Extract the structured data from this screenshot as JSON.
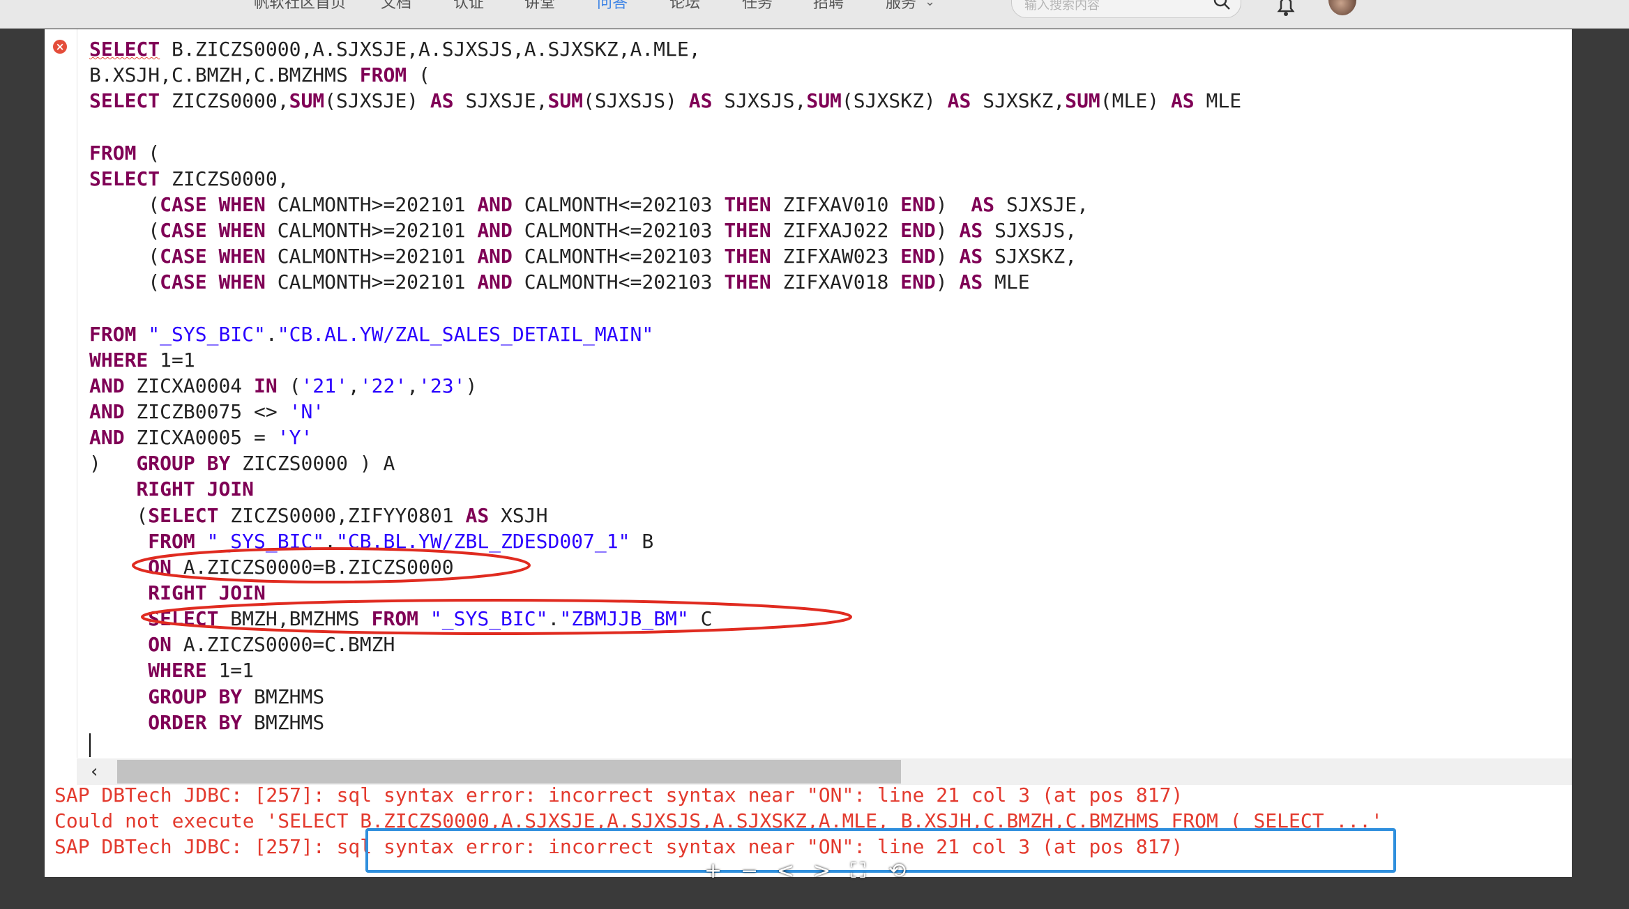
{
  "site_nav": {
    "items": [
      "帆软社区首页",
      "文档",
      "认证",
      "讲堂",
      "问答",
      "论坛",
      "任务",
      "招聘",
      "服务"
    ],
    "active_index": 4,
    "search_placeholder": "输入搜索内容",
    "icons": [
      "search-icon",
      "bell-icon",
      "avatar"
    ]
  },
  "editor": {
    "code_lines": [
      [
        {
          "t": "SELECT",
          "c": "kw",
          "squiggle": true
        },
        {
          "t": " B.ZICZS0000,A.SJXSJE,A.SJXSJS,A.SJXSKZ,A.MLE,"
        }
      ],
      [
        {
          "t": "B.XSJH,C.BMZH,C.BMZHMS "
        },
        {
          "t": "FROM",
          "c": "kw"
        },
        {
          "t": " ("
        }
      ],
      [
        {
          "t": "SELECT",
          "c": "kw"
        },
        {
          "t": " ZICZS0000,"
        },
        {
          "t": "SUM",
          "c": "kw"
        },
        {
          "t": "(SJXSJE) "
        },
        {
          "t": "AS",
          "c": "kw"
        },
        {
          "t": " SJXSJE,"
        },
        {
          "t": "SUM",
          "c": "kw"
        },
        {
          "t": "(SJXSJS) "
        },
        {
          "t": "AS",
          "c": "kw"
        },
        {
          "t": " SJXSJS,"
        },
        {
          "t": "SUM",
          "c": "kw"
        },
        {
          "t": "(SJXSKZ) "
        },
        {
          "t": "AS",
          "c": "kw"
        },
        {
          "t": " SJXSKZ,"
        },
        {
          "t": "SUM",
          "c": "kw"
        },
        {
          "t": "(MLE) "
        },
        {
          "t": "AS",
          "c": "kw"
        },
        {
          "t": " MLE"
        }
      ],
      [
        {
          "t": ""
        }
      ],
      [
        {
          "t": "FROM",
          "c": "kw"
        },
        {
          "t": " ("
        }
      ],
      [
        {
          "t": "SELECT",
          "c": "kw"
        },
        {
          "t": " ZICZS0000,"
        }
      ],
      [
        {
          "t": "     ("
        },
        {
          "t": "CASE",
          "c": "kw"
        },
        {
          "t": " "
        },
        {
          "t": "WHEN",
          "c": "kw"
        },
        {
          "t": " CALMONTH>=202101 "
        },
        {
          "t": "AND",
          "c": "kw"
        },
        {
          "t": " CALMONTH<=202103 "
        },
        {
          "t": "THEN",
          "c": "kw"
        },
        {
          "t": " ZIFXAV010 "
        },
        {
          "t": "END",
          "c": "kw"
        },
        {
          "t": ")  "
        },
        {
          "t": "AS",
          "c": "kw"
        },
        {
          "t": " SJXSJE,"
        }
      ],
      [
        {
          "t": "     ("
        },
        {
          "t": "CASE",
          "c": "kw"
        },
        {
          "t": " "
        },
        {
          "t": "WHEN",
          "c": "kw"
        },
        {
          "t": " CALMONTH>=202101 "
        },
        {
          "t": "AND",
          "c": "kw"
        },
        {
          "t": " CALMONTH<=202103 "
        },
        {
          "t": "THEN",
          "c": "kw"
        },
        {
          "t": " ZIFXAJ022 "
        },
        {
          "t": "END",
          "c": "kw"
        },
        {
          "t": ") "
        },
        {
          "t": "AS",
          "c": "kw"
        },
        {
          "t": " SJXSJS,"
        }
      ],
      [
        {
          "t": "     ("
        },
        {
          "t": "CASE",
          "c": "kw"
        },
        {
          "t": " "
        },
        {
          "t": "WHEN",
          "c": "kw"
        },
        {
          "t": " CALMONTH>=202101 "
        },
        {
          "t": "AND",
          "c": "kw"
        },
        {
          "t": " CALMONTH<=202103 "
        },
        {
          "t": "THEN",
          "c": "kw"
        },
        {
          "t": " ZIFXAW023 "
        },
        {
          "t": "END",
          "c": "kw"
        },
        {
          "t": ") "
        },
        {
          "t": "AS",
          "c": "kw"
        },
        {
          "t": " SJXSKZ,"
        }
      ],
      [
        {
          "t": "     ("
        },
        {
          "t": "CASE",
          "c": "kw"
        },
        {
          "t": " "
        },
        {
          "t": "WHEN",
          "c": "kw"
        },
        {
          "t": " CALMONTH>=202101 "
        },
        {
          "t": "AND",
          "c": "kw"
        },
        {
          "t": " CALMONTH<=202103 "
        },
        {
          "t": "THEN",
          "c": "kw"
        },
        {
          "t": " ZIFXAV018 "
        },
        {
          "t": "END",
          "c": "kw"
        },
        {
          "t": ") "
        },
        {
          "t": "AS",
          "c": "kw"
        },
        {
          "t": " MLE"
        }
      ],
      [
        {
          "t": ""
        }
      ],
      [
        {
          "t": "FROM",
          "c": "kw"
        },
        {
          "t": " "
        },
        {
          "t": "\"_SYS_BIC\"",
          "c": "str"
        },
        {
          "t": "."
        },
        {
          "t": "\"CB.AL.YW/ZAL_SALES_DETAIL_MAIN\"",
          "c": "str"
        }
      ],
      [
        {
          "t": "WHERE",
          "c": "kw"
        },
        {
          "t": " 1=1"
        }
      ],
      [
        {
          "t": "AND",
          "c": "kw"
        },
        {
          "t": " ZICXA0004 "
        },
        {
          "t": "IN",
          "c": "kw"
        },
        {
          "t": " ("
        },
        {
          "t": "'21'",
          "c": "str"
        },
        {
          "t": ","
        },
        {
          "t": "'22'",
          "c": "str"
        },
        {
          "t": ","
        },
        {
          "t": "'23'",
          "c": "str"
        },
        {
          "t": ")"
        }
      ],
      [
        {
          "t": "AND",
          "c": "kw"
        },
        {
          "t": " ZICZB0075 <> "
        },
        {
          "t": "'N'",
          "c": "str"
        }
      ],
      [
        {
          "t": "AND",
          "c": "kw"
        },
        {
          "t": " ZICXA0005 = "
        },
        {
          "t": "'Y'",
          "c": "str"
        }
      ],
      [
        {
          "t": ")   "
        },
        {
          "t": "GROUP",
          "c": "kw"
        },
        {
          "t": " "
        },
        {
          "t": "BY",
          "c": "kw"
        },
        {
          "t": " ZICZS0000 ) A"
        }
      ],
      [
        {
          "t": "    "
        },
        {
          "t": "RIGHT",
          "c": "kw"
        },
        {
          "t": " "
        },
        {
          "t": "JOIN",
          "c": "kw"
        }
      ],
      [
        {
          "t": "    (",
          "c": ""
        },
        {
          "t": "SELECT",
          "c": "kw"
        },
        {
          "t": " ZICZS0000,ZIFYY0801 "
        },
        {
          "t": "AS",
          "c": "kw"
        },
        {
          "t": " XSJH"
        }
      ],
      [
        {
          "t": "     "
        },
        {
          "t": "FROM",
          "c": "kw"
        },
        {
          "t": " "
        },
        {
          "t": "\"_SYS_BIC\"",
          "c": "str"
        },
        {
          "t": "."
        },
        {
          "t": "\"CB.BL.YW/ZBL_ZDESD007_1\"",
          "c": "str"
        },
        {
          "t": " B"
        }
      ],
      [
        {
          "t": "     "
        },
        {
          "t": "ON",
          "c": "kw"
        },
        {
          "t": " A.ZICZS0000=B.ZICZS0000"
        }
      ],
      [
        {
          "t": "     "
        },
        {
          "t": "RIGHT",
          "c": "kw"
        },
        {
          "t": " "
        },
        {
          "t": "JOIN",
          "c": "kw"
        }
      ],
      [
        {
          "t": "     "
        },
        {
          "t": "SELECT",
          "c": "kw"
        },
        {
          "t": " BMZH,BMZHMS "
        },
        {
          "t": "FROM",
          "c": "kw"
        },
        {
          "t": " "
        },
        {
          "t": "\"_SYS_BIC\"",
          "c": "str"
        },
        {
          "t": "."
        },
        {
          "t": "\"ZBMJJB_BM\"",
          "c": "str"
        },
        {
          "t": " C"
        }
      ],
      [
        {
          "t": "     "
        },
        {
          "t": "ON",
          "c": "kw"
        },
        {
          "t": " A.ZICZS0000=C.BMZH"
        }
      ],
      [
        {
          "t": "     "
        },
        {
          "t": "WHERE",
          "c": "kw"
        },
        {
          "t": " 1=1"
        }
      ],
      [
        {
          "t": "     "
        },
        {
          "t": "GROUP",
          "c": "kw"
        },
        {
          "t": " "
        },
        {
          "t": "BY",
          "c": "kw"
        },
        {
          "t": " BMZHMS"
        }
      ],
      [
        {
          "t": "     "
        },
        {
          "t": "ORDER",
          "c": "kw"
        },
        {
          "t": " "
        },
        {
          "t": "BY",
          "c": "kw"
        },
        {
          "t": " BMZHMS"
        }
      ]
    ],
    "error_marker": "×",
    "scroll_left_arrow": "‹"
  },
  "console": {
    "lines": [
      "SAP DBTech JDBC: [257]: sql syntax error: incorrect syntax near \"ON\": line 21 col 3 (at pos 817)",
      "Could not execute 'SELECT B.ZICZS0000,A.SJXSJE,A.SJXSJS,A.SJXSKZ,A.MLE, B.XSJH,C.BMZH,C.BMZHMS FROM ( SELECT ...'",
      "SAP DBTech JDBC: [257]: sql syntax error: incorrect syntax near \"ON\": line 21 col 3 (at pos 817)"
    ]
  },
  "viewer_toolbar": {
    "buttons": [
      "+",
      "−",
      "<",
      ">",
      "⛶",
      "⟲"
    ]
  },
  "colors": {
    "keyword": "#7f0055",
    "string": "#2a00ff",
    "error": "#e33a2e",
    "annotation_red": "#e02b20",
    "annotation_blue": "#2f8fdd"
  }
}
